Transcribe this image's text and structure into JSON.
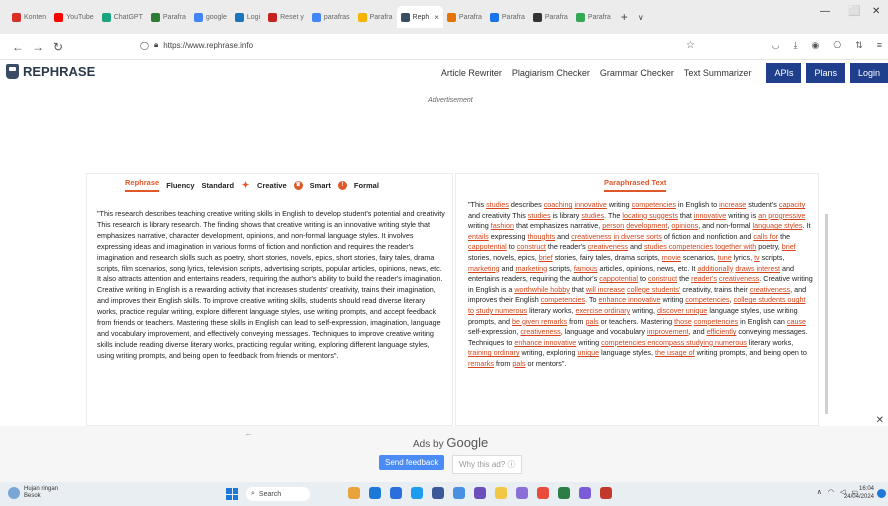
{
  "browser": {
    "tabs": [
      {
        "label": "Konten",
        "color": "#d93025",
        "active": false
      },
      {
        "label": "YouTube",
        "color": "#ff0000",
        "active": false
      },
      {
        "label": "ChatGPT",
        "color": "#19a37f",
        "active": false
      },
      {
        "label": "Parafra",
        "color": "#2e7d32",
        "active": false
      },
      {
        "label": "google",
        "color": "#4285f4",
        "active": false
      },
      {
        "label": "Logi",
        "color": "#1b75bb",
        "active": false
      },
      {
        "label": "Reset y",
        "color": "#c5221f",
        "active": false
      },
      {
        "label": "parafras",
        "color": "#4285f4",
        "active": false
      },
      {
        "label": "Parafra",
        "color": "#f5b400",
        "active": false
      },
      {
        "label": "Reph",
        "color": "#3a4c63",
        "active": true
      },
      {
        "label": "Parafra",
        "color": "#e37400",
        "active": false
      },
      {
        "label": "Parafra",
        "color": "#1a73e8",
        "active": false
      },
      {
        "label": "Parafra",
        "color": "#333333",
        "active": false
      },
      {
        "label": "Parafra",
        "color": "#34a853",
        "active": false
      }
    ],
    "tab_close": "×",
    "new_tab": "+",
    "url": "https://www.rephrase.info"
  },
  "site": {
    "logo_text": "REPHRASE",
    "nav_links": [
      "Article Rewriter",
      "Plagiarism Checker",
      "Grammar Checker",
      "Text Summarizer"
    ],
    "nav_buttons": [
      "APIs",
      "Plans",
      "Login"
    ],
    "ad_label": "Advertisement"
  },
  "editor": {
    "modes": [
      "Rephrase",
      "Fluency",
      "Standard",
      "Creative",
      "Smart",
      "Formal"
    ],
    "active_mode": "Rephrase",
    "output_tab": "Paraphrased Text",
    "input_text": "\"This research describes teaching creative writing skills in English to develop student's potential and creativity This research is library research. The finding shows that creative writing is an innovative writing style that emphasizes narrative, character development, opinions, and non-formal language styles. It involves expressing ideas and imagination in various forms of fiction and nonfiction and requires the reader's imagination and research skills such as poetry, short stories, novels, epics, short stories, fairy tales, drama scripts, film scenarios, song lyrics, television scripts, advertising scripts, popular articles, opinions, news, etc. It also attracts attention and entertains readers, requiring the author's ability to build the reader's imagination. Creative writing in English is a rewarding activity that increases students' creativity, trains their imagination, and improves their English skills. To improve creative writing skills, students should read diverse literary works, practice regular writing, explore different language styles, use writing prompts, and accept feedback from friends or teachers. Mastering these skills in English can lead to self-expression, imagination, language and vocabulary improvement, and effectively conveying messages. Techniques to improve creative writing skills include reading diverse literary works, practicing regular writing, exploring different language styles, using writing prompts, and being open to feedback from friends or mentors\".",
    "output_segments": [
      {
        "t": "\"This ",
        "c": false
      },
      {
        "t": "studies",
        "c": true
      },
      {
        "t": " describes ",
        "c": false
      },
      {
        "t": "coaching",
        "c": true
      },
      {
        "t": " ",
        "c": false
      },
      {
        "t": "innovative",
        "c": true
      },
      {
        "t": " writing ",
        "c": false
      },
      {
        "t": "competencies",
        "c": true
      },
      {
        "t": " in English to ",
        "c": false
      },
      {
        "t": "increase",
        "c": true
      },
      {
        "t": " student's ",
        "c": false
      },
      {
        "t": "capacity",
        "c": true
      },
      {
        "t": " and creativity This ",
        "c": false
      },
      {
        "t": "studies",
        "c": true
      },
      {
        "t": " is library ",
        "c": false
      },
      {
        "t": "studies",
        "c": true
      },
      {
        "t": ". The ",
        "c": false
      },
      {
        "t": "locating suggests",
        "c": true
      },
      {
        "t": " that ",
        "c": false
      },
      {
        "t": "innovative",
        "c": true
      },
      {
        "t": " writing is ",
        "c": false
      },
      {
        "t": "an progressive",
        "c": true
      },
      {
        "t": " writing ",
        "c": false
      },
      {
        "t": "fashion",
        "c": true
      },
      {
        "t": " that emphasizes narrative, ",
        "c": false
      },
      {
        "t": "person",
        "c": true
      },
      {
        "t": " ",
        "c": false
      },
      {
        "t": "development",
        "c": true
      },
      {
        "t": ", ",
        "c": false
      },
      {
        "t": "opinions",
        "c": true
      },
      {
        "t": ", and non-formal ",
        "c": false
      },
      {
        "t": "language styles",
        "c": true
      },
      {
        "t": ". It ",
        "c": false
      },
      {
        "t": "entails",
        "c": true
      },
      {
        "t": " expressing ",
        "c": false
      },
      {
        "t": "thoughts",
        "c": true
      },
      {
        "t": " and ",
        "c": false
      },
      {
        "t": "creativeness",
        "c": true
      },
      {
        "t": " ",
        "c": false
      },
      {
        "t": "in diverse sorts",
        "c": true
      },
      {
        "t": " of fiction and nonfiction and ",
        "c": false
      },
      {
        "t": "calls for",
        "c": true
      },
      {
        "t": " the ",
        "c": false
      },
      {
        "t": "cappotential",
        "c": true
      },
      {
        "t": " to ",
        "c": false
      },
      {
        "t": "construct",
        "c": true
      },
      {
        "t": " the reader's ",
        "c": false
      },
      {
        "t": "creativeness",
        "c": true
      },
      {
        "t": " and ",
        "c": false
      },
      {
        "t": "studies competencies together with",
        "c": true
      },
      {
        "t": " poetry, ",
        "c": false
      },
      {
        "t": "brief",
        "c": true
      },
      {
        "t": " stories, novels, epics, ",
        "c": false
      },
      {
        "t": "brief",
        "c": true
      },
      {
        "t": " stories, fairy tales, drama scripts, ",
        "c": false
      },
      {
        "t": "movie",
        "c": true
      },
      {
        "t": " scenarios, ",
        "c": false
      },
      {
        "t": "tune",
        "c": true
      },
      {
        "t": " lyrics, ",
        "c": false
      },
      {
        "t": "tv",
        "c": true
      },
      {
        "t": " scripts, ",
        "c": false
      },
      {
        "t": "marketing",
        "c": true
      },
      {
        "t": " and ",
        "c": false
      },
      {
        "t": "marketing",
        "c": true
      },
      {
        "t": " scripts, ",
        "c": false
      },
      {
        "t": "famous",
        "c": true
      },
      {
        "t": " articles, opinions, news, etc. It ",
        "c": false
      },
      {
        "t": "additionally",
        "c": true
      },
      {
        "t": " ",
        "c": false
      },
      {
        "t": "draws interest",
        "c": true
      },
      {
        "t": " and entertains readers, requiring the author's ",
        "c": false
      },
      {
        "t": "cappotential",
        "c": true
      },
      {
        "t": " to ",
        "c": false
      },
      {
        "t": "construct",
        "c": true
      },
      {
        "t": " the ",
        "c": false
      },
      {
        "t": "reader's",
        "c": true
      },
      {
        "t": " ",
        "c": false
      },
      {
        "t": "creativeness",
        "c": true
      },
      {
        "t": ". Creative writing in English is a ",
        "c": false
      },
      {
        "t": "worthwhile hobby",
        "c": true
      },
      {
        "t": " that ",
        "c": false
      },
      {
        "t": "will increase",
        "c": true
      },
      {
        "t": " ",
        "c": false
      },
      {
        "t": "college students'",
        "c": true
      },
      {
        "t": " creativity, trains their ",
        "c": false
      },
      {
        "t": "creativeness",
        "c": true
      },
      {
        "t": ", and improves their English ",
        "c": false
      },
      {
        "t": "competencies",
        "c": true
      },
      {
        "t": ". To ",
        "c": false
      },
      {
        "t": "enhance innovative",
        "c": true
      },
      {
        "t": " writing ",
        "c": false
      },
      {
        "t": "competencies",
        "c": true
      },
      {
        "t": ", ",
        "c": false
      },
      {
        "t": "college students ought to",
        "c": true
      },
      {
        "t": " ",
        "c": false
      },
      {
        "t": "study numerous",
        "c": true
      },
      {
        "t": " literary works, ",
        "c": false
      },
      {
        "t": "exercise ordinary",
        "c": true
      },
      {
        "t": " writing, ",
        "c": false
      },
      {
        "t": "discover unique",
        "c": true
      },
      {
        "t": " language styles,",
        "c": false
      },
      {
        "t": " use writing prompts, and ",
        "c": false
      },
      {
        "t": "be given remarks",
        "c": true
      },
      {
        "t": " from ",
        "c": false
      },
      {
        "t": "pals",
        "c": true
      },
      {
        "t": " or teachers. Mastering ",
        "c": false
      },
      {
        "t": "those",
        "c": true
      },
      {
        "t": " ",
        "c": false
      },
      {
        "t": "competencies",
        "c": true
      },
      {
        "t": " in English can ",
        "c": false
      },
      {
        "t": "cause",
        "c": true
      },
      {
        "t": " self-expression, ",
        "c": false
      },
      {
        "t": "creativeness",
        "c": true
      },
      {
        "t": ", language and vocabulary ",
        "c": false
      },
      {
        "t": "improvement",
        "c": true
      },
      {
        "t": ", and ",
        "c": false
      },
      {
        "t": "efficiently",
        "c": true
      },
      {
        "t": " conveying messages. Techniques to ",
        "c": false
      },
      {
        "t": "enhance innovative",
        "c": true
      },
      {
        "t": " writing ",
        "c": false
      },
      {
        "t": "competencies encompass studying numerous",
        "c": true
      },
      {
        "t": " literary works, ",
        "c": false
      },
      {
        "t": "training ordinary",
        "c": true
      },
      {
        "t": " writing, ",
        "c": false
      },
      {
        "t": " exploring ",
        "c": false
      },
      {
        "t": "unique",
        "c": true
      },
      {
        "t": " language styles, ",
        "c": false
      },
      {
        "t": "the usage of",
        "c": true
      },
      {
        "t": " writing prompts, and being open to ",
        "c": false
      },
      {
        "t": "remarks",
        "c": true
      },
      {
        "t": " from ",
        "c": false
      },
      {
        "t": "pals",
        "c": true
      },
      {
        "t": " or mentors\".",
        "c": false
      }
    ]
  },
  "ad_footer": {
    "ads_by": "Ads by",
    "google": "Google",
    "send_feedback": "Send feedback",
    "why_this_ad": "Why this ad? ⓘ"
  },
  "taskbar": {
    "weather_line1": "Hujan ringan",
    "weather_line2": "Besok",
    "search_label": "Search",
    "time": "16:04",
    "date": "24/04/2024",
    "app_colors": [
      "#e9a33b",
      "#1e78d7",
      "#2a6fdb",
      "#1d9bf0",
      "#3b5998",
      "#4a90e2",
      "#6b4fbb",
      "#f2c744",
      "#8a6fd6",
      "#e74c3c",
      "#2d7d46",
      "#7b5cd6",
      "#c0392b"
    ]
  }
}
